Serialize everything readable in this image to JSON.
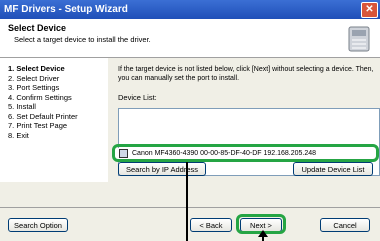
{
  "window": {
    "title": "MF Drivers - Setup Wizard",
    "close_glyph": "✕"
  },
  "header": {
    "title": "Select Device",
    "subtitle": "Select a target device to install the driver.",
    "icon": "printer-icon"
  },
  "steps": [
    {
      "label": "1.  Select Device",
      "active": true
    },
    {
      "label": "2.  Select Driver",
      "active": false
    },
    {
      "label": "3.  Port Settings",
      "active": false
    },
    {
      "label": "4.  Confirm Settings",
      "active": false
    },
    {
      "label": "5.  Install",
      "active": false
    },
    {
      "label": "6.  Set Default Printer",
      "active": false
    },
    {
      "label": "7.  Print Test Page",
      "active": false
    },
    {
      "label": "8.  Exit",
      "active": false
    }
  ],
  "main": {
    "note": "If the target device is not listed below, click [Next] without selecting a device. Then, you can manually set the port to install.",
    "device_list_label": "Device List:",
    "device_row": "Canon MF4360-4390   00-00-85-DF-40-DF    192.168.205.248",
    "search_ip_button": "Search by IP Address",
    "update_list_button": "Update Device List"
  },
  "footer": {
    "search_option_button": "Search Option",
    "back_button": "< Back",
    "next_button": "Next >",
    "cancel_button": "Cancel"
  },
  "colors": {
    "titlebar": "#2456c4",
    "highlight": "#25a544",
    "panel": "#f0efe6"
  }
}
